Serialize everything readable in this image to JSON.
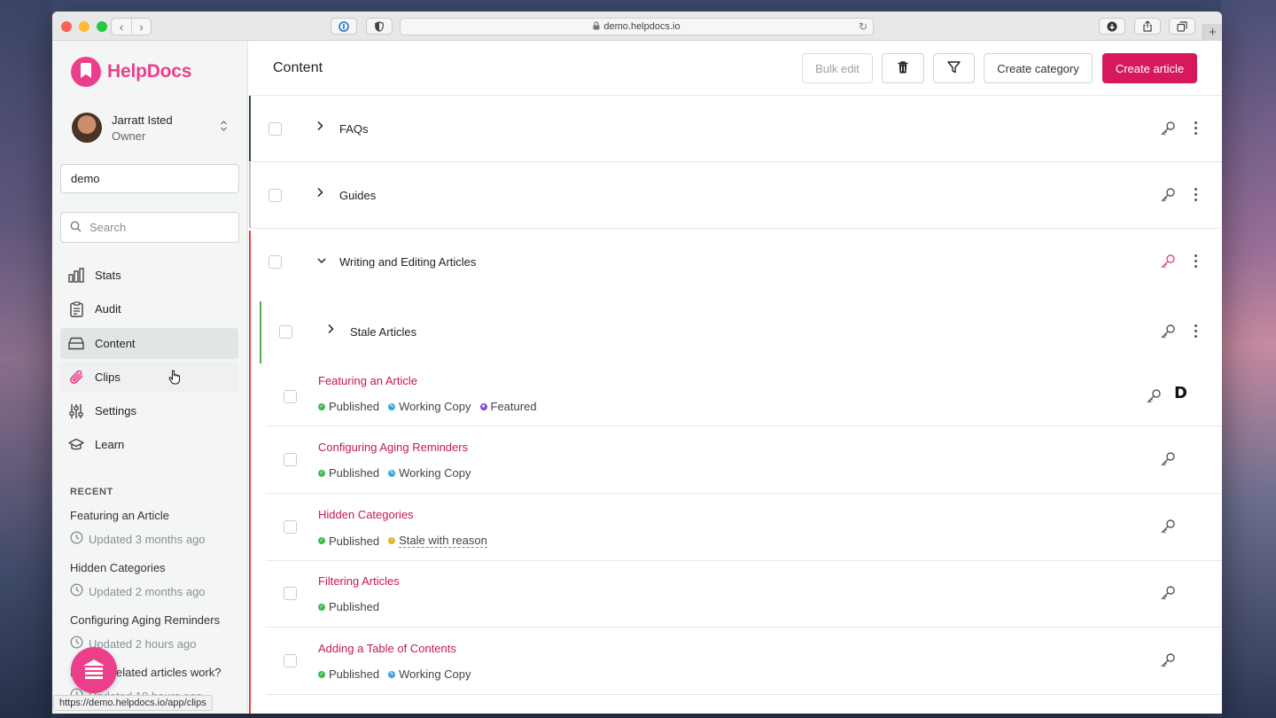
{
  "browser": {
    "url": "demo.helpdocs.io",
    "status_url": "https://demo.helpdocs.io/app/clips"
  },
  "brand": {
    "name": "HelpDocs"
  },
  "user": {
    "name": "Jarratt Isted",
    "role": "Owner"
  },
  "kb_name": "demo",
  "search": {
    "placeholder": "Search"
  },
  "nav": [
    {
      "label": "Stats",
      "icon": "bar-chart-icon"
    },
    {
      "label": "Audit",
      "icon": "clipboard-icon"
    },
    {
      "label": "Content",
      "icon": "inbox-icon",
      "active": true
    },
    {
      "label": "Clips",
      "icon": "paperclip-icon",
      "hover": true
    },
    {
      "label": "Settings",
      "icon": "sliders-icon"
    },
    {
      "label": "Learn",
      "icon": "graduation-cap-icon"
    }
  ],
  "recent": {
    "heading": "RECENT",
    "items": [
      {
        "title": "Featuring an Article",
        "time": "Updated 3 months ago"
      },
      {
        "title": "Hidden Categories",
        "time": "Updated 2 months ago"
      },
      {
        "title": "Configuring Aging Reminders",
        "time": "Updated 2 hours ago"
      },
      {
        "title": "How do related articles work?",
        "time": "Updated 18 hours ago"
      }
    ]
  },
  "main": {
    "title": "Content",
    "buttons": {
      "bulk_edit": "Bulk edit",
      "create_category": "Create category",
      "create_article": "Create article"
    },
    "categories": [
      {
        "label": "FAQs",
        "color": "#2f4f3f"
      },
      {
        "label": "Guides",
        "color": "#c7b8c9"
      },
      {
        "label": "Writing and Editing Articles",
        "color": "#e34343",
        "expanded": true
      },
      {
        "label": "Stale Articles",
        "color": "#4caf50"
      }
    ],
    "articles": [
      {
        "title": "Featuring an Article",
        "badges": [
          {
            "label": "Published",
            "type": "published"
          },
          {
            "label": "Working Copy",
            "type": "working"
          },
          {
            "label": "Featured",
            "type": "featured"
          }
        ]
      },
      {
        "title": "Configuring Aging Reminders",
        "badges": [
          {
            "label": "Published",
            "type": "published"
          },
          {
            "label": "Working Copy",
            "type": "working"
          }
        ]
      },
      {
        "title": "Hidden Categories",
        "badges": [
          {
            "label": "Published",
            "type": "published"
          },
          {
            "label": "Stale with reason",
            "type": "stale"
          }
        ]
      },
      {
        "title": "Filtering Articles",
        "badges": [
          {
            "label": "Published",
            "type": "published"
          }
        ]
      },
      {
        "title": "Adding a Table of Contents",
        "badges": [
          {
            "label": "Published",
            "type": "published"
          },
          {
            "label": "Working Copy",
            "type": "working"
          }
        ]
      }
    ],
    "featured_mark": "D"
  },
  "colors": {
    "brand": "#ec3f8b",
    "primary_button": "#d7185c",
    "article_link": "#c5175a",
    "published": "#3fb950",
    "working": "#3aa7d6",
    "featured": "#7b4bd6",
    "stale": "#e0b52b"
  }
}
